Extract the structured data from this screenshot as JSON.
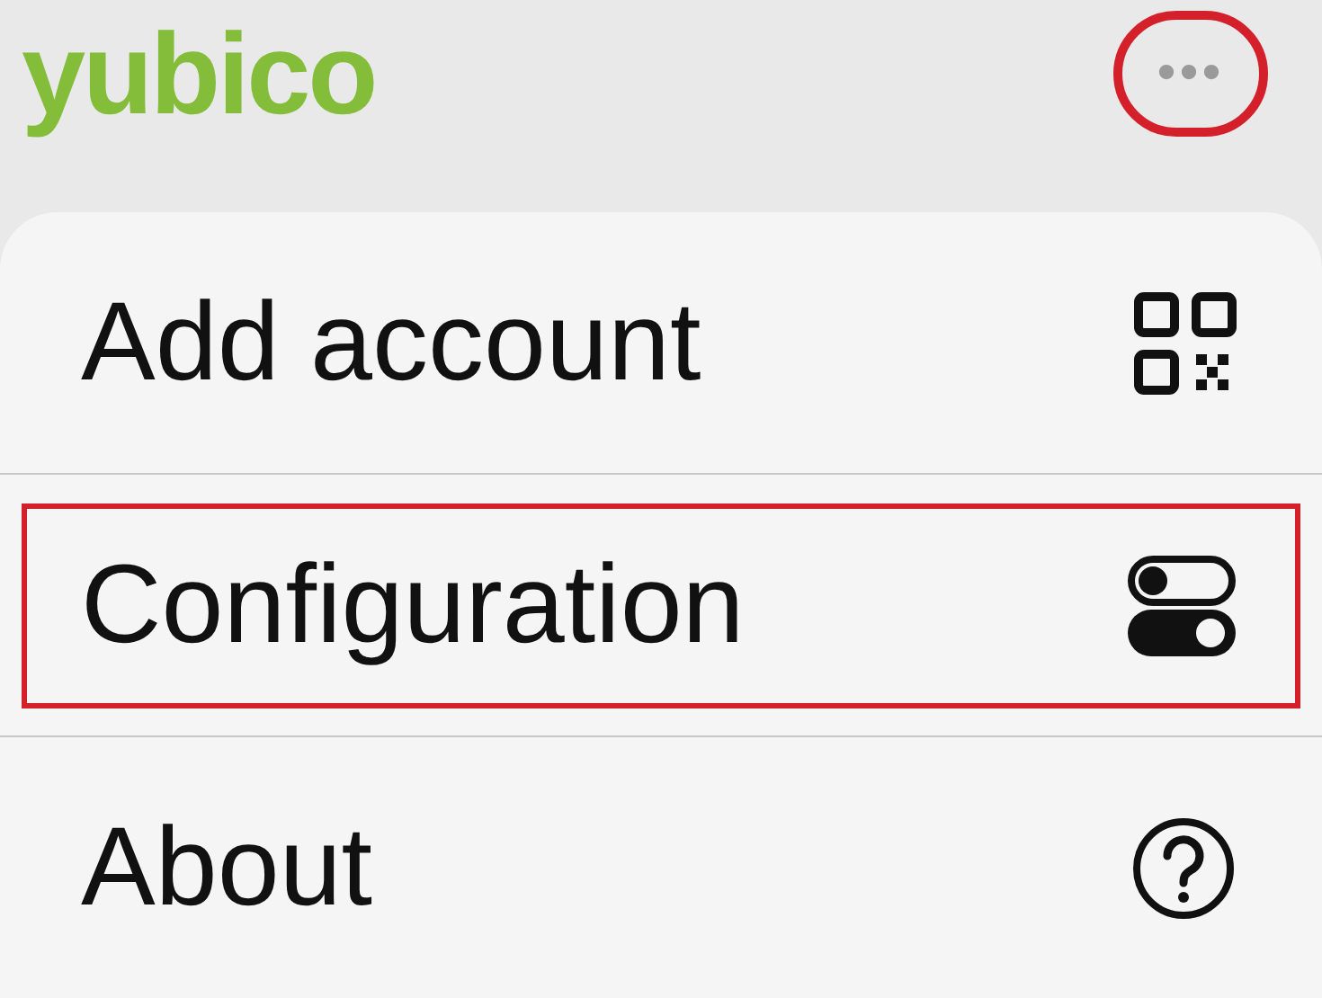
{
  "header": {
    "logo": "yubico",
    "more_button": {
      "label": "•••",
      "annotated": true
    }
  },
  "menu": [
    {
      "label": "Add account",
      "kind": "qr",
      "annotated": false
    },
    {
      "label": "Configuration",
      "kind": "toggles",
      "annotated": true
    },
    {
      "label": "About",
      "kind": "help",
      "annotated": false
    }
  ]
}
